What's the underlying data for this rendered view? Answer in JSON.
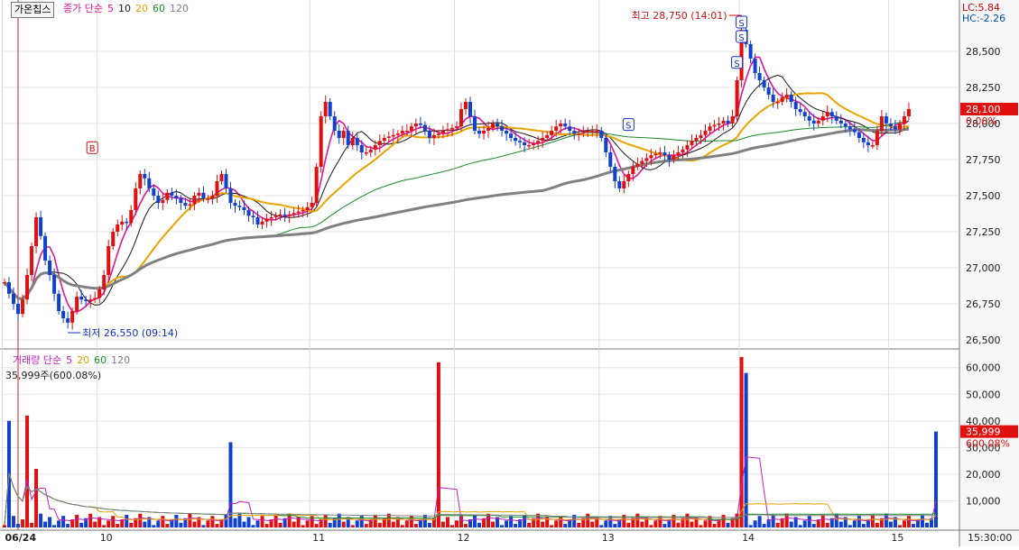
{
  "stock": {
    "name": "가온칩스"
  },
  "price_legend": {
    "label": "종가 단순",
    "periods": [
      "5",
      "10",
      "20",
      "60",
      "120"
    ],
    "colors": [
      "#e0169b",
      "#1a1a1a",
      "#e8a400",
      "#1a8a2a",
      "#808080"
    ]
  },
  "volume_legend": {
    "label": "거래량 단순",
    "periods": [
      "5",
      "20",
      "60",
      "120"
    ],
    "colors": [
      "#c020c0",
      "#e8a400",
      "#1a8a2a",
      "#808080"
    ]
  },
  "volume_summary": "35,999주(600.08%)",
  "lc_label": "LC:5.84",
  "hc_label": "HC:-2.26",
  "annotations": {
    "high": "최고 28,750 (14:01)",
    "low": "최저 26,550 (09:14)",
    "buy_marker": "B",
    "sell_marker": "S"
  },
  "chart_data": [
    {
      "type": "candlestick",
      "title": "",
      "x_labels": [
        "06/24",
        "10",
        "11",
        "12",
        "13",
        "14",
        "15",
        "15:30:00"
      ],
      "y_ticks": [
        "28,500",
        "28,250",
        "28,000",
        "27,750",
        "27,500",
        "27,250",
        "27,000",
        "26,750",
        "26,500"
      ],
      "ylim": [
        26450,
        28850
      ],
      "current_price": {
        "value": 28100,
        "label": "28,100",
        "change": "0.00%"
      },
      "high": 28750,
      "low": 26550,
      "day_open_index": [
        0,
        21,
        68,
        100,
        132,
        163,
        196
      ],
      "n": 207,
      "close_series": [
        26900,
        26820,
        26750,
        26680,
        26780,
        26950,
        27150,
        27350,
        27220,
        27050,
        26950,
        26820,
        26700,
        26650,
        26620,
        26700,
        26800,
        26780,
        26770,
        26780,
        26790,
        26850,
        26950,
        27150,
        27250,
        27300,
        27320,
        27310,
        27400,
        27550,
        27650,
        27620,
        27550,
        27500,
        27450,
        27470,
        27520,
        27500,
        27480,
        27450,
        27430,
        27440,
        27500,
        27520,
        27480,
        27480,
        27500,
        27600,
        27650,
        27550,
        27450,
        27430,
        27420,
        27400,
        27360,
        27350,
        27300,
        27320,
        27340,
        27350,
        27360,
        27370,
        27360,
        27370,
        27380,
        27390,
        27400,
        27420,
        27450,
        27700,
        28050,
        28150,
        28050,
        27950,
        27900,
        27950,
        27850,
        27900,
        27850,
        27800,
        27800,
        27820,
        27850,
        27880,
        27900,
        27910,
        27920,
        27930,
        27950,
        27950,
        27980,
        28000,
        27990,
        27950,
        27900,
        27920,
        27930,
        27950,
        27960,
        27970,
        27980,
        28100,
        28150,
        28050,
        27950,
        27930,
        27950,
        27970,
        28000,
        27980,
        27950,
        27930,
        27900,
        27880,
        27870,
        27850,
        27850,
        27860,
        27880,
        27900,
        27920,
        27950,
        27980,
        28000,
        27980,
        27950,
        27930,
        27930,
        27940,
        27950,
        27950,
        27950,
        27900,
        27800,
        27700,
        27600,
        27550,
        27600,
        27650,
        27700,
        27720,
        27740,
        27760,
        27780,
        27790,
        27800,
        27780,
        27750,
        27780,
        27800,
        27820,
        27850,
        27880,
        27900,
        27920,
        27950,
        27980,
        27990,
        28000,
        28020,
        28000,
        28050,
        28300,
        28650,
        28550,
        28450,
        28350,
        28300,
        28250,
        28200,
        28150,
        28150,
        28180,
        28200,
        28150,
        28100,
        28080,
        28050,
        28020,
        28000,
        28020,
        28050,
        28080,
        28050,
        28020,
        28000,
        27980,
        27960,
        27940,
        27900,
        27870,
        27850,
        27850,
        27950,
        28050,
        28000,
        27980,
        27960,
        28000,
        28050,
        28100
      ]
    },
    {
      "type": "bar",
      "title": "",
      "y_ticks": [
        "60,000",
        "50,000",
        "40,000",
        "30,000",
        "20,000",
        "10,000"
      ],
      "ylim": [
        0,
        66000
      ],
      "current": {
        "label": "35,999",
        "pct": "600.08%"
      },
      "spike_index": [
        1,
        5,
        7,
        50,
        96,
        163,
        164,
        206
      ],
      "spike_values": [
        40000,
        42000,
        22000,
        32000,
        62000,
        64000,
        58000,
        36000
      ],
      "base_value": 3000
    }
  ]
}
